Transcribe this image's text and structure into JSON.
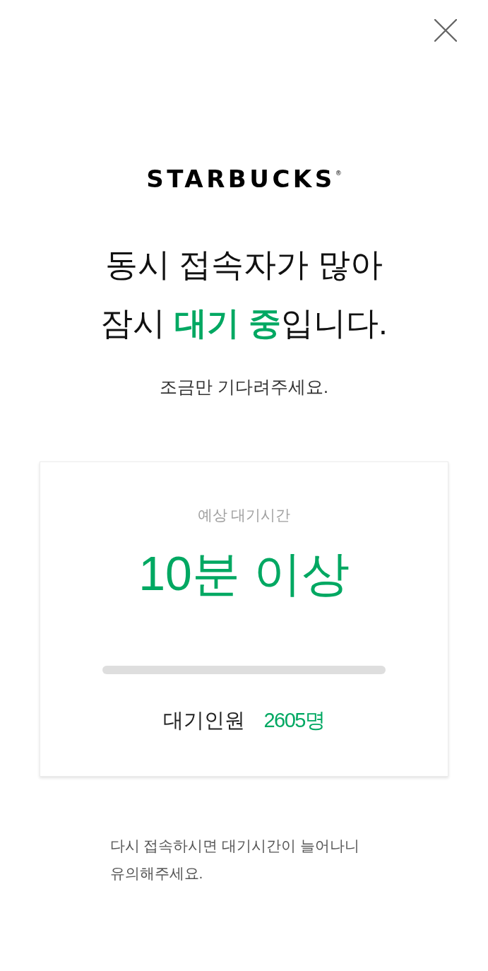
{
  "logo": {
    "text": "STARBUCKS$^{®}$"
  },
  "headline": {
    "lines": [
      "동시 접속자가 많아",
      "잠시 **대기 중**입니다."
    ]
  },
  "subtitle": "조금만 기다려주세요.",
  "wait_card": {
    "label": "예상 대기시간",
    "estimate": "10분 이상",
    "queue_label": "대기인원",
    "queue_count": "2605명"
  },
  "notice": "다시 접속하시면 대기시간이 늘어나니 유의해주세요."
}
